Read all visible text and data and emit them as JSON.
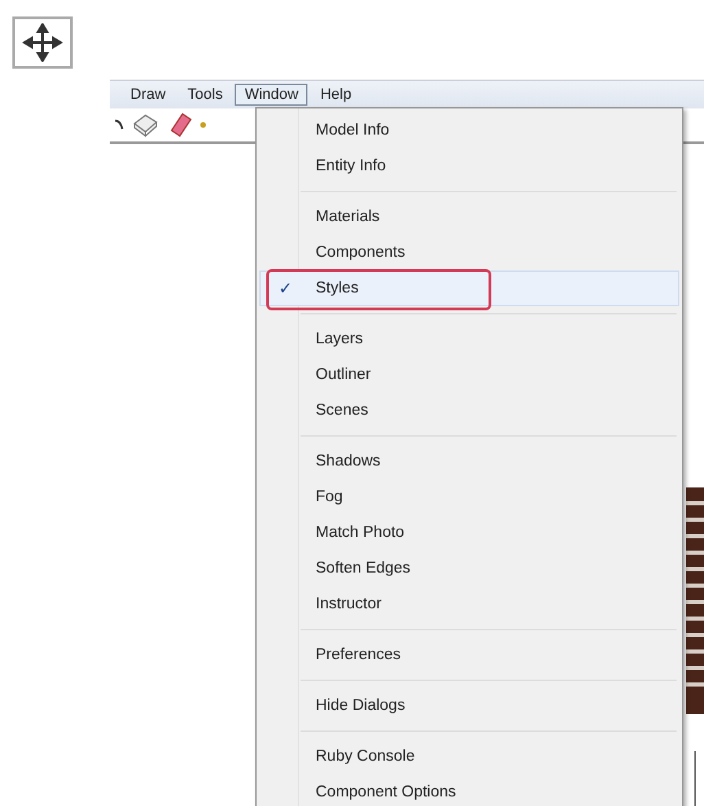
{
  "menu_bar": [
    {
      "label": "Draw",
      "selected": false
    },
    {
      "label": "Tools",
      "selected": false
    },
    {
      "label": "Window",
      "selected": true
    },
    {
      "label": "Help",
      "selected": false
    }
  ],
  "window_menu": {
    "groups": [
      [
        {
          "label": "Model Info",
          "checked": false,
          "hovered": false,
          "outlined": false
        },
        {
          "label": "Entity Info",
          "checked": false,
          "hovered": false,
          "outlined": false
        }
      ],
      [
        {
          "label": "Materials",
          "checked": false,
          "hovered": false,
          "outlined": false
        },
        {
          "label": "Components",
          "checked": false,
          "hovered": false,
          "outlined": false
        },
        {
          "label": "Styles",
          "checked": true,
          "hovered": true,
          "outlined": true
        }
      ],
      [
        {
          "label": "Layers",
          "checked": false,
          "hovered": false,
          "outlined": false
        },
        {
          "label": "Outliner",
          "checked": false,
          "hovered": false,
          "outlined": false
        },
        {
          "label": "Scenes",
          "checked": false,
          "hovered": false,
          "outlined": false
        }
      ],
      [
        {
          "label": "Shadows",
          "checked": false,
          "hovered": false,
          "outlined": false
        },
        {
          "label": "Fog",
          "checked": false,
          "hovered": false,
          "outlined": false
        },
        {
          "label": "Match Photo",
          "checked": false,
          "hovered": false,
          "outlined": false
        },
        {
          "label": "Soften Edges",
          "checked": false,
          "hovered": false,
          "outlined": false
        },
        {
          "label": "Instructor",
          "checked": false,
          "hovered": false,
          "outlined": false
        }
      ],
      [
        {
          "label": "Preferences",
          "checked": false,
          "hovered": false,
          "outlined": false
        }
      ],
      [
        {
          "label": "Hide Dialogs",
          "checked": false,
          "hovered": false,
          "outlined": false
        }
      ],
      [
        {
          "label": "Ruby Console",
          "checked": false,
          "hovered": false,
          "outlined": false
        },
        {
          "label": "Component Options",
          "checked": false,
          "hovered": false,
          "outlined": false
        }
      ]
    ]
  },
  "check_mark": "✓"
}
